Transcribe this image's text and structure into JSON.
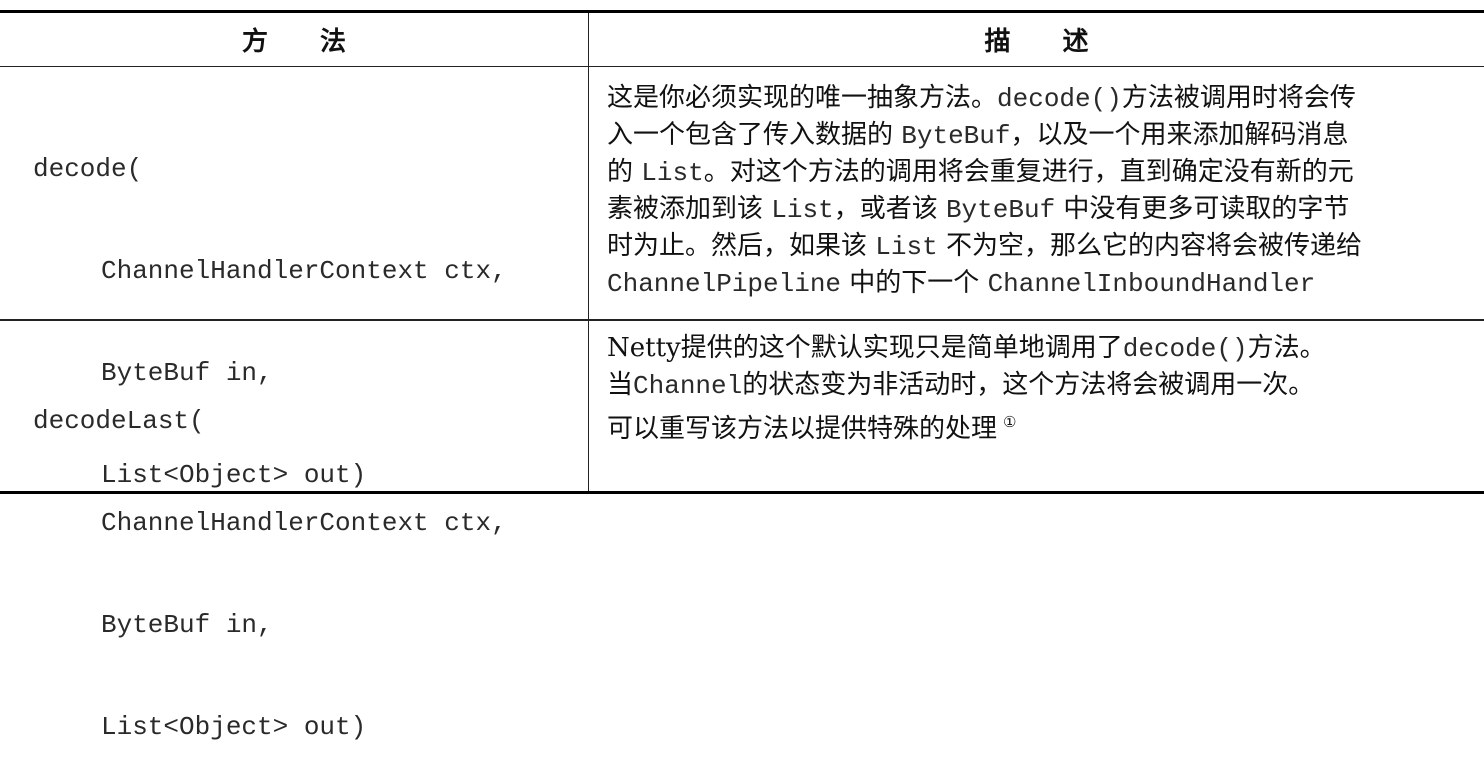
{
  "table": {
    "headers": {
      "method": "方　　法",
      "description": "描　　述"
    },
    "rows": [
      {
        "method": {
          "name_open": "decode(",
          "param1": "ChannelHandlerContext ctx,",
          "param2": "ByteBuf in,",
          "param3": "List<Object> out)"
        },
        "description_lines": [
          {
            "a": "这是你必须实现的唯一抽象方法。",
            "code1": "decode()",
            "b": "方法被调用时将会传"
          },
          {
            "a": "入一个包含了传入数据的 ",
            "code1": "ByteBuf",
            "b": "，以及一个用来添加解码消息"
          },
          {
            "a": "的 ",
            "code1": "List",
            "b": "。对这个方法的调用将会重复进行，直到确定没有新的元"
          },
          {
            "a": "素被添加到该 ",
            "code1": "List",
            "b": "，或者该 ",
            "code2": "ByteBuf",
            "c": " 中没有更多可读取的字节"
          },
          {
            "a": "时为止。然后，如果该 ",
            "code1": "List",
            "b": " 不为空，那么它的内容将会被传递给"
          },
          {
            "code1": "ChannelPipeline",
            "b": " 中的下一个 ",
            "code2": "ChannelInboundHandler"
          }
        ]
      },
      {
        "method": {
          "name_open": "decodeLast(",
          "param1": "ChannelHandlerContext ctx,",
          "param2": "ByteBuf in,",
          "param3": "List<Object> out)"
        },
        "description_lines": [
          {
            "a": "Netty提供的这个默认实现只是简单地调用了",
            "code1": "decode()",
            "b": "方法。"
          },
          {
            "a": "当",
            "code1": "Channel",
            "b": "的状态变为非活动时，这个方法将会被调用一次。"
          },
          {
            "a": "可以重写该方法以提供特殊的处理",
            "footnote": "①"
          }
        ]
      }
    ]
  }
}
